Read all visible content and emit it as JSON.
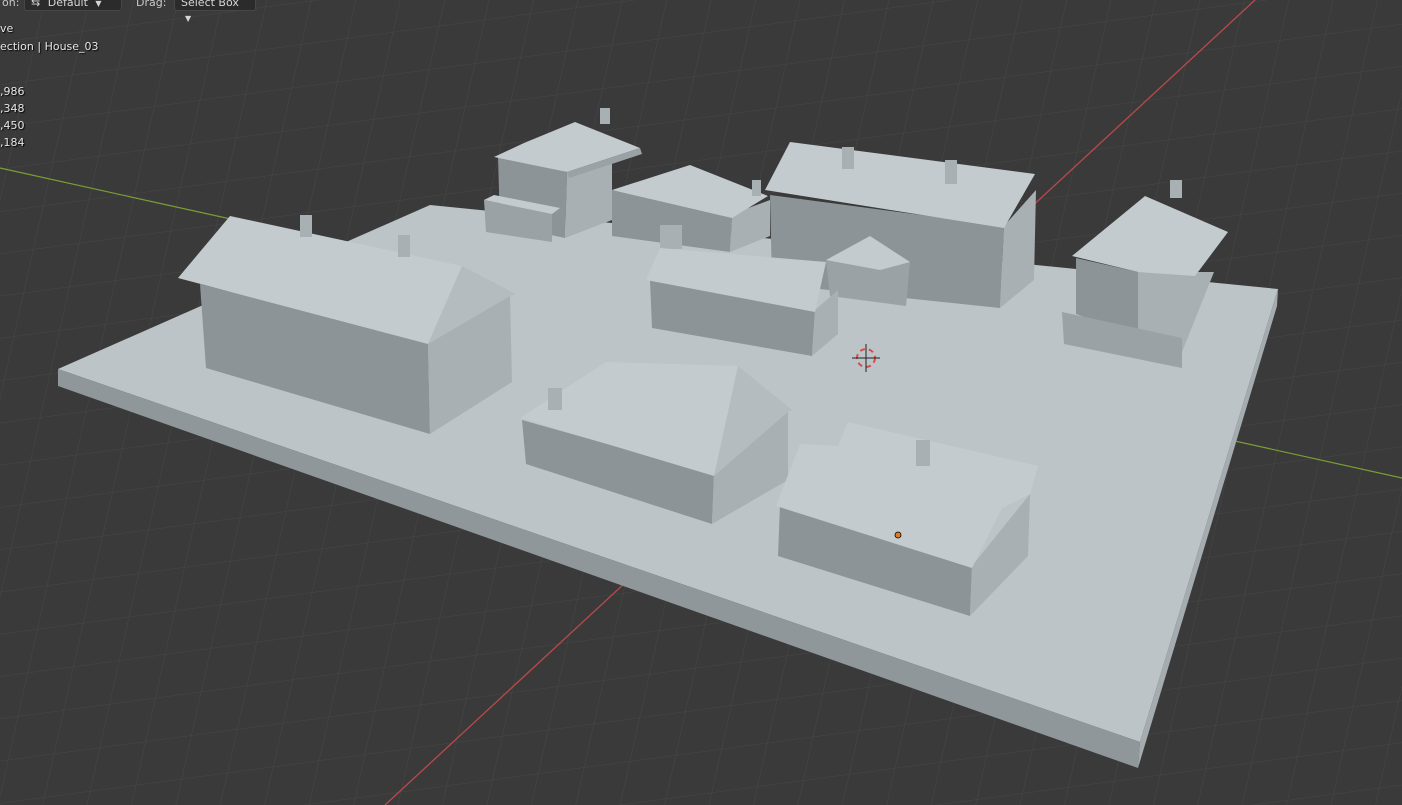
{
  "header": {
    "orientation_label": "on:",
    "orientation_value": "Default",
    "drag_label": "Drag:",
    "drag_value": "Select Box"
  },
  "overlay": {
    "mode_text": "ve",
    "collection_text": "ection | House_03",
    "stats": [
      ",986",
      ",348",
      ",450",
      ",184"
    ]
  },
  "colors": {
    "background": "#3a3a3a",
    "grid": "#474747",
    "x_axis": "#b94a4a",
    "y_axis": "#7aa033",
    "ground_top": "#bcc4c8",
    "wall": "#8d9498",
    "roof_light": "#c4cbcf"
  },
  "icons": [
    "transform-orientation-icon",
    "chevron-down-icon",
    "3d-cursor-icon",
    "origin-dot-icon"
  ]
}
